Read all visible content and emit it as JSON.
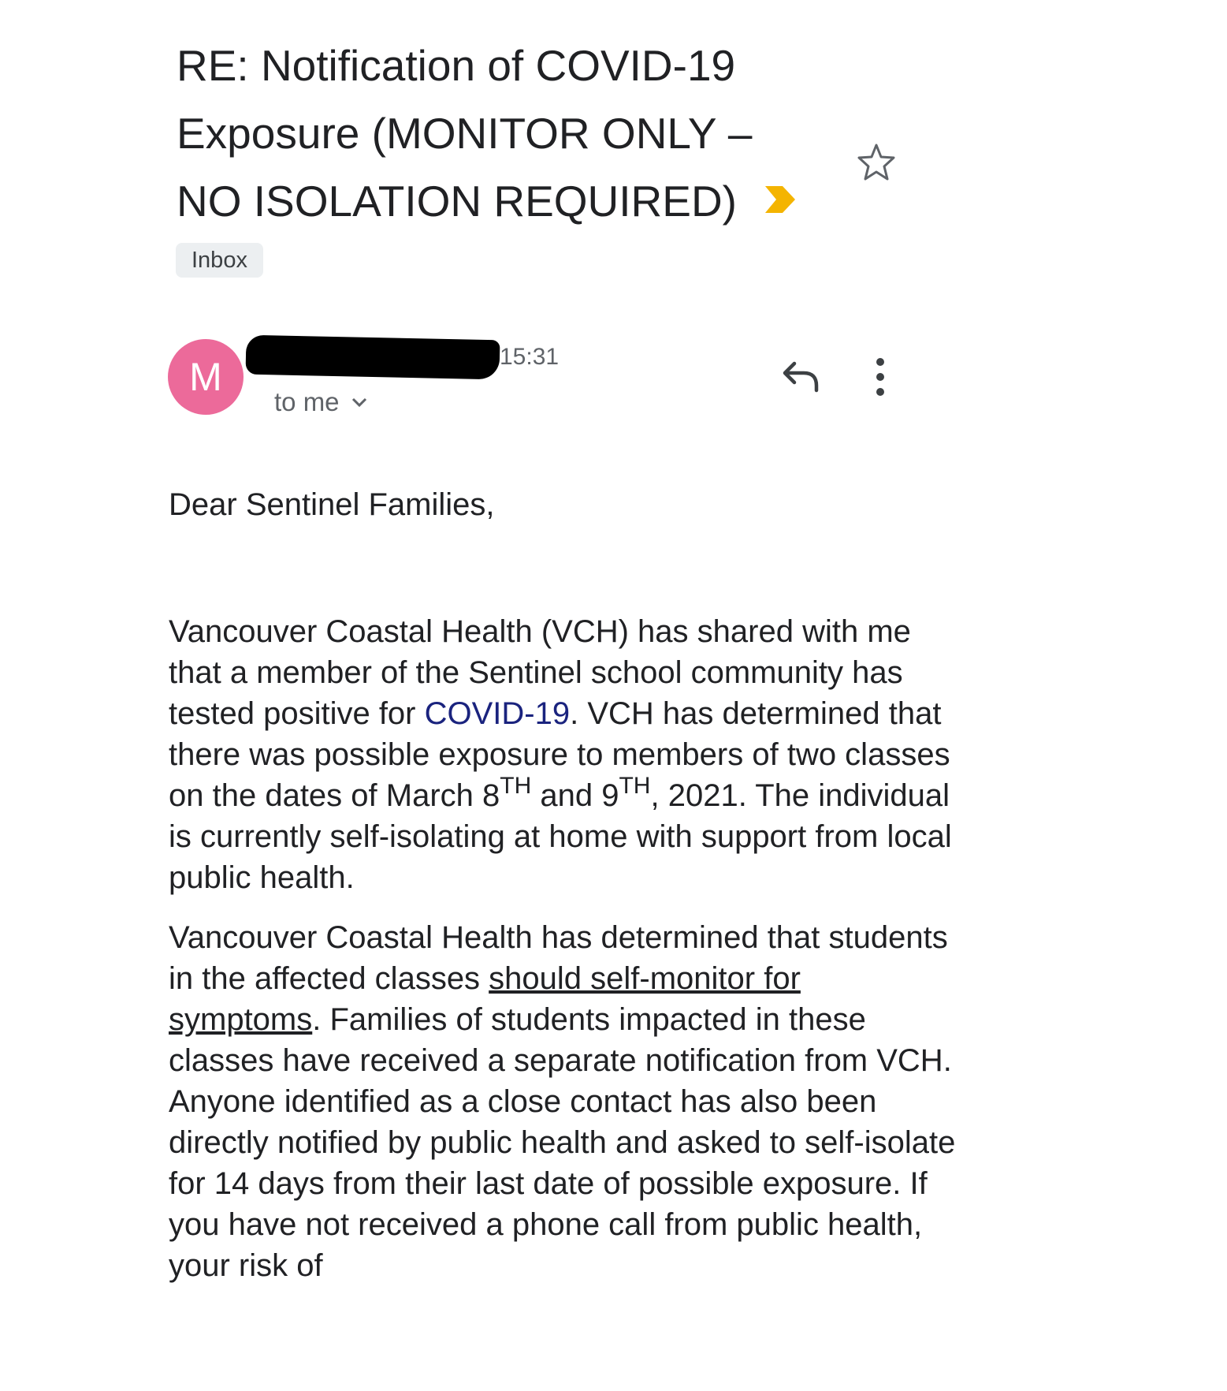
{
  "subject": {
    "line1": "RE: Notification of COVID-19",
    "line2": "Exposure  (MONITOR ONLY –",
    "line3": "NO ISOLATION REQUIRED)",
    "importance_icon": "importance-marker-icon",
    "importance_color": "#f4b400"
  },
  "label": "Inbox",
  "message": {
    "avatar_letter": "M",
    "avatar_color": "#ec6a9a",
    "time": "15:31",
    "recipient": "to me"
  },
  "body": {
    "greeting": "Dear Sentinel Families,",
    "p1": {
      "a": "Vancouver Coastal Health (VCH) has shared with me that a member of the Sentinel school community has tested positive for ",
      "link": "COVID-19",
      "b": ". VCH has determined that there was possible exposure to members of two classes on the dates of March 8",
      "sup1": "TH",
      "c": " and 9",
      "sup2": "TH",
      "d": ", 2021. The individual is currently self-isolating at home with support from local public health."
    },
    "p2": {
      "a": "Vancouver Coastal Health has determined that students in the affected classes ",
      "underlined": "should self-monitor for symptoms",
      "b": ".   Families of students impacted in these classes have received a separate notification from VCH.  Anyone identified as a close contact has also been directly notified by public health and asked to self-isolate for 14 days from their last date of possible exposure.  If you have not received a phone call from public health, your risk of"
    }
  }
}
